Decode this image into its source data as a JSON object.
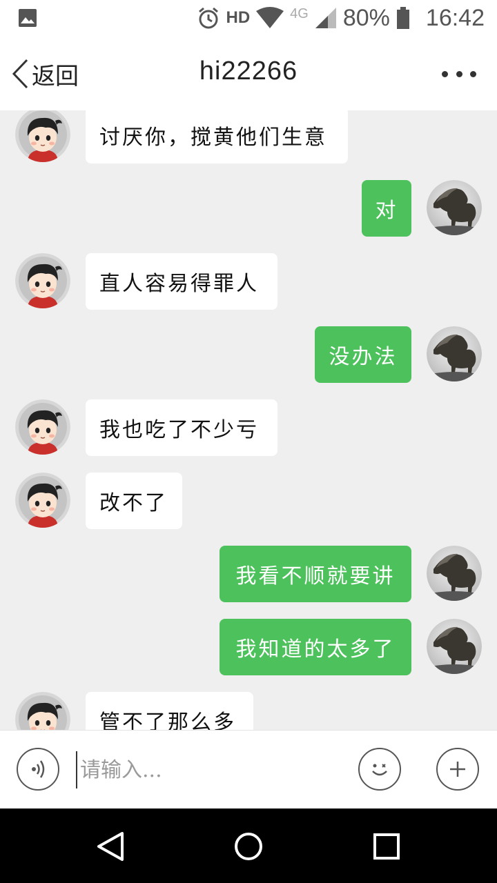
{
  "status_bar": {
    "hd": "HD",
    "network": "4G",
    "battery": "80%",
    "time": "16:42"
  },
  "header": {
    "back_label": "返回",
    "title": "hi22266"
  },
  "messages": [
    {
      "side": "in",
      "text": "讨厌你，搅黄他们生意"
    },
    {
      "side": "out",
      "text": "对"
    },
    {
      "side": "in",
      "text": "直人容易得罪人"
    },
    {
      "side": "out",
      "text": "没办法"
    },
    {
      "side": "in",
      "text": "我也吃了不少亏"
    },
    {
      "side": "in",
      "text": "改不了"
    },
    {
      "side": "out",
      "text": "我看不顺就要讲"
    },
    {
      "side": "out",
      "text": "我知道的太多了"
    },
    {
      "side": "in",
      "text": "管不了那么多"
    }
  ],
  "input": {
    "placeholder": "请输入..."
  },
  "icons": {
    "voice": "voice-icon",
    "emoji": "emoji-icon",
    "plus": "plus-icon",
    "back": "back-triangle-icon",
    "home": "home-circle-icon",
    "recents": "recents-square-icon"
  },
  "colors": {
    "outgoing_bubble": "#4cc15c",
    "incoming_bubble": "#ffffff",
    "chat_background": "#efefef"
  }
}
